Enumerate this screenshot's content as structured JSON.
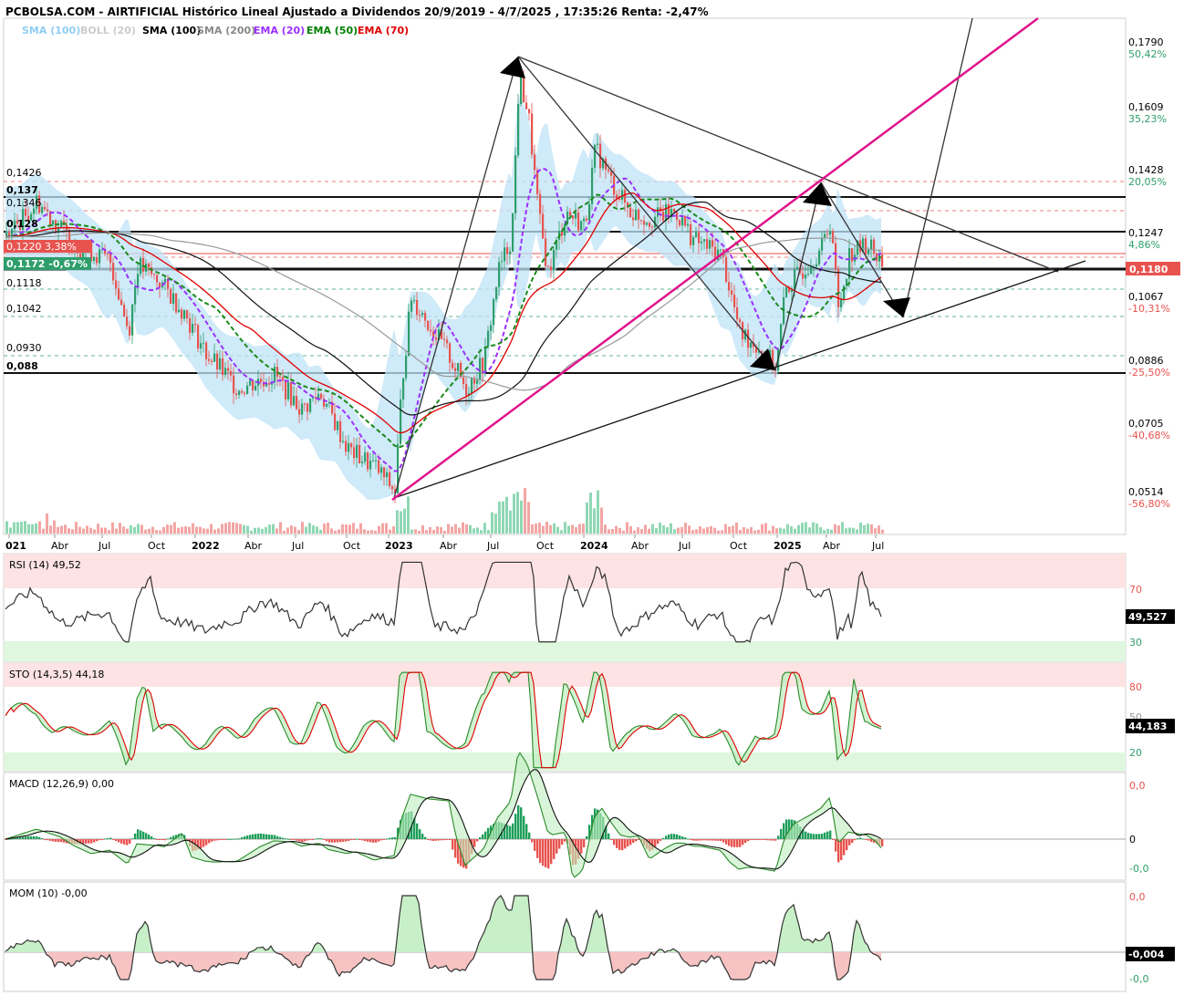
{
  "header": {
    "title": "PCBOLSA.COM - AIRTIFICIAL Histórico Lineal Ajustado a Dividendos 20/9/2019 - 4/7/2025 , 17:35:26 Renta: -2,47%"
  },
  "legend": [
    {
      "label": "SMA (100)",
      "color": "#90cdf4"
    },
    {
      "label": "BOLL (20)",
      "color": "#cccccc"
    },
    {
      "label": "SMA (100)",
      "color": "#000000"
    },
    {
      "label": "SMA (200)",
      "color": "#888888"
    },
    {
      "label": "EMA (20)",
      "color": "#9b30ff"
    },
    {
      "label": "EMA (50)",
      "color": "#008000"
    },
    {
      "label": "EMA (70)",
      "color": "#e00000"
    }
  ],
  "colors": {
    "up": "#2e9e6b",
    "down": "#e8534f",
    "boll": "#bfe3f7",
    "pink": "#e0148c"
  },
  "chart_data": [
    {
      "type": "candlestick",
      "title": "AIRTIFICIAL",
      "x_tick_labels": [
        "021",
        "Abr",
        "Jul",
        "Oct",
        "2022",
        "Abr",
        "Jul",
        "Oct",
        "2023",
        "Abr",
        "Jul",
        "Oct",
        "2024",
        "Abr",
        "Jul",
        "Oct",
        "2025",
        "Abr",
        "Jul"
      ],
      "y_axis_ticks": [
        {
          "price": "0,1790",
          "pct": "50,42%",
          "pct_color": "#2e9e6b"
        },
        {
          "price": "0,1609",
          "pct": "35,23%",
          "pct_color": "#2e9e6b"
        },
        {
          "price": "0,1428",
          "pct": "20,05%",
          "pct_color": "#2e9e6b"
        },
        {
          "price": "0,1247",
          "pct": "4,86%",
          "pct_color": "#2e9e6b"
        },
        {
          "price": "0,1067",
          "pct": "-10,31%",
          "pct_color": "#e8534f"
        },
        {
          "price": "0,0886",
          "pct": "-25,50%",
          "pct_color": "#e8534f"
        },
        {
          "price": "0,0705",
          "pct": "-40,68%",
          "pct_color": "#e8534f"
        },
        {
          "price": "0,0514",
          "pct": "-56,80%",
          "pct_color": "#e8534f"
        }
      ],
      "last_price": "0,1180",
      "left_levels": [
        "0,1426",
        "0,137",
        "0,1346",
        "0,128",
        "0,1220",
        "3,38%",
        "0,1172",
        "-0,67%",
        "0,1118",
        "0,1042",
        "0,0930",
        "0,088"
      ],
      "ylim": [
        0.05,
        0.188
      ]
    },
    {
      "type": "line",
      "title": "RSI (14)",
      "value": "49,52",
      "last": "49,527",
      "levels": [
        "70",
        "30"
      ],
      "ylim": [
        0,
        100
      ]
    },
    {
      "type": "line",
      "title": "STO (14,3,5)",
      "value": "44,18",
      "last": "44,183",
      "levels": [
        "80",
        "50",
        "20"
      ],
      "ylim": [
        0,
        100
      ]
    },
    {
      "type": "line",
      "title": "MACD (12,26,9)",
      "value": "0,00",
      "levels": [
        "0,0",
        "0",
        "-0,0"
      ]
    },
    {
      "type": "line",
      "title": "MOM (10)",
      "value": "-0,00",
      "last": "-0,004",
      "levels": [
        "0,0",
        "-0,0"
      ]
    }
  ]
}
